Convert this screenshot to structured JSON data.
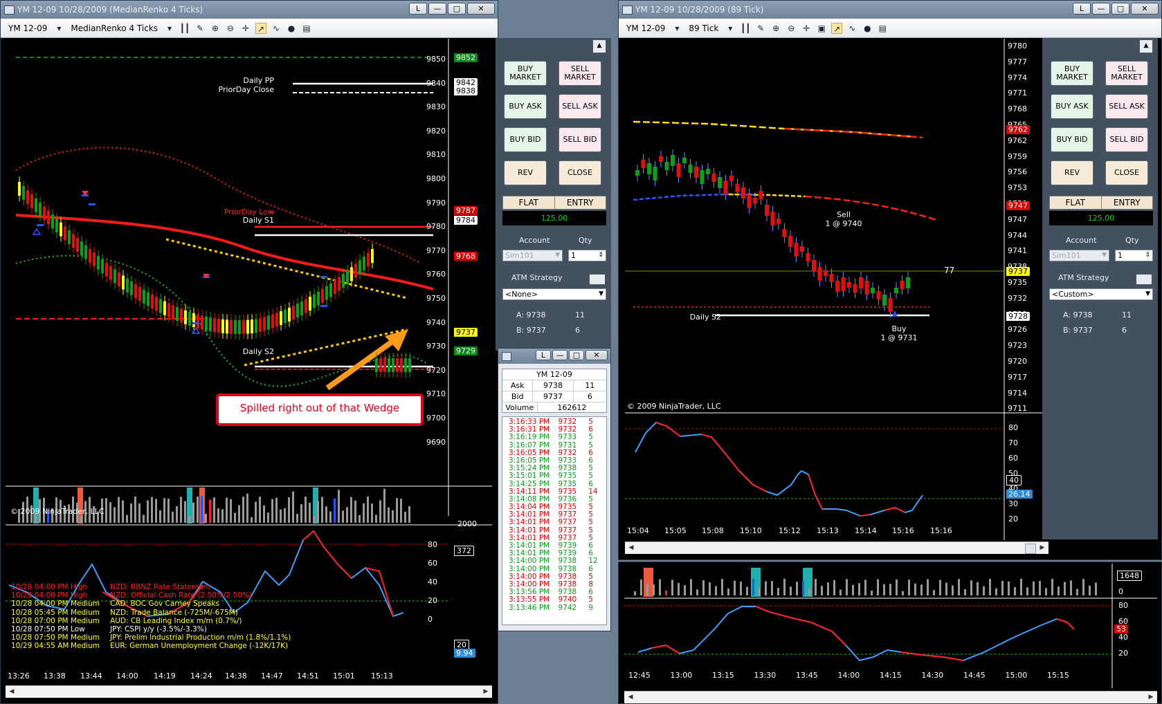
{
  "left_window": {
    "title": "YM 12-09  10/28/2009 (MedianRenko 4 Ticks)",
    "toolbar": {
      "instrument": "YM 12-09",
      "period": "MedianRenko 4 Ticks"
    },
    "price_axis": [
      "9850",
      "9840",
      "9830",
      "9820",
      "9810",
      "9800",
      "9790",
      "9780",
      "9770",
      "9760",
      "9750",
      "9740",
      "9730",
      "9720",
      "9710",
      "9700",
      "9690"
    ],
    "price_tags": {
      "top": "9852",
      "pp1": "9842",
      "pp2": "9840",
      "prior_close": "9838",
      "prior_low": "9787",
      "s1": "9784",
      "red_band": "9768",
      "last": "9737",
      "s2": "9729"
    },
    "levels": {
      "daily_pp": "Daily PP",
      "prior_close": "PriorDay Close",
      "prior_low": "PriorDay Low",
      "daily_s1": "Daily S1",
      "daily_s2": "Daily S2"
    },
    "callout": "Spilled right out of that Wedge",
    "copyright": "© 2009 NinjaTrader, LLC",
    "volume_axis": {
      "top": "2000",
      "tag": "372"
    },
    "osc_axis": [
      "80",
      "60",
      "40",
      "20",
      "0"
    ],
    "osc_tags": {
      "t20": "20",
      "val": "9.94"
    },
    "time_axis": [
      "13:26",
      "13:38",
      "13:44",
      "14:00",
      "14:19",
      "14:24",
      "14:38",
      "14:47",
      "14:51",
      "15:01",
      "15:13"
    ],
    "news": [
      {
        "time": "10/28 04:00 PM",
        "impact": "High",
        "text": "NZD: RBNZ Rate Statement",
        "color": "#ff2020"
      },
      {
        "time": "10/28 04:00 PM",
        "impact": "High",
        "text": "NZD: Official Cash Rate (2.50%/2.50%)",
        "color": "#ff2020"
      },
      {
        "time": "10/28 04:00 PM",
        "impact": "Medium",
        "text": "CAD: BOC Gov Carney Speaks",
        "color": "#ffff20"
      },
      {
        "time": "10/28 05:45 PM",
        "impact": "Medium",
        "text": "NZD: Trade Balance (-725M/-675M)",
        "color": "#ffff20"
      },
      {
        "time": "10/28 07:00 PM",
        "impact": "Medium",
        "text": "AUD: CB Leading Index m/m (0.7%/)",
        "color": "#ffff20"
      },
      {
        "time": "10/28 07:50 PM",
        "impact": "Low",
        "text": "JPY: CSPI y/y (-3.5%/-3.3%)",
        "color": "#ffffff"
      },
      {
        "time": "10/28 07:50 PM",
        "impact": "Medium",
        "text": "JPY: Prelim Industrial Production m/m (1.8%/1.1%)",
        "color": "#ffff20"
      },
      {
        "time": "10/29 04:55 AM",
        "impact": "Medium",
        "text": "EUR: German Unemployment Change (-12K/17K)",
        "color": "#ffff20"
      }
    ]
  },
  "order_panel_left": {
    "buy_market": "BUY MARKET",
    "sell_market": "SELL MARKET",
    "buy_ask": "BUY ASK",
    "sell_ask": "SELL ASK",
    "buy_bid": "BUY BID",
    "sell_bid": "SELL BID",
    "rev": "REV",
    "close": "CLOSE",
    "flat": "FLAT",
    "entry": "ENTRY",
    "pnl": "125.00",
    "account_label": "Account",
    "qty_label": "Qty",
    "account": "Sim101",
    "qty": "1",
    "atm_label": "ATM Strategy",
    "atm": "<None>",
    "a_label": "A: 9738",
    "a_size": "11",
    "b_label": "B: 9737",
    "b_size": "6"
  },
  "tas": {
    "instrument": "YM 12-09",
    "ask_label": "Ask",
    "ask": "9738",
    "ask_size": "11",
    "bid_label": "Bid",
    "bid": "9737",
    "bid_size": "6",
    "volume_label": "Volume",
    "volume": "162612",
    "rows": [
      {
        "t": "3:16:33 PM",
        "p": "9732",
        "s": "5",
        "c": "#e00000"
      },
      {
        "t": "3:16:31 PM",
        "p": "9732",
        "s": "6",
        "c": "#e00000"
      },
      {
        "t": "3:16:19 PM",
        "p": "9733",
        "s": "5",
        "c": "#0a9a1a"
      },
      {
        "t": "3:16:07 PM",
        "p": "9731",
        "s": "5",
        "c": "#0a9a1a"
      },
      {
        "t": "3:16:05 PM",
        "p": "9732",
        "s": "6",
        "c": "#e00000"
      },
      {
        "t": "3:16:05 PM",
        "p": "9733",
        "s": "6",
        "c": "#0a9a1a"
      },
      {
        "t": "3:15:24 PM",
        "p": "9738",
        "s": "5",
        "c": "#0a9a1a"
      },
      {
        "t": "3:15:01 PM",
        "p": "9735",
        "s": "5",
        "c": "#0a9a1a"
      },
      {
        "t": "3:14:25 PM",
        "p": "9735",
        "s": "6",
        "c": "#0a9a1a"
      },
      {
        "t": "3:14:11 PM",
        "p": "9735",
        "s": "14",
        "c": "#e00000"
      },
      {
        "t": "3:14:08 PM",
        "p": "9736",
        "s": "5",
        "c": "#0a9a1a"
      },
      {
        "t": "3:14:04 PM",
        "p": "9735",
        "s": "5",
        "c": "#e00000"
      },
      {
        "t": "3:14:01 PM",
        "p": "9737",
        "s": "5",
        "c": "#e00000"
      },
      {
        "t": "3:14:01 PM",
        "p": "9737",
        "s": "5",
        "c": "#e00000"
      },
      {
        "t": "3:14:01 PM",
        "p": "9737",
        "s": "5",
        "c": "#e00000"
      },
      {
        "t": "3:14:01 PM",
        "p": "9737",
        "s": "5",
        "c": "#e00000"
      },
      {
        "t": "3:14:01 PM",
        "p": "9739",
        "s": "6",
        "c": "#0a9a1a"
      },
      {
        "t": "3:14:01 PM",
        "p": "9739",
        "s": "6",
        "c": "#0a9a1a"
      },
      {
        "t": "3:14:00 PM",
        "p": "9738",
        "s": "12",
        "c": "#0a9a1a"
      },
      {
        "t": "3:14:00 PM",
        "p": "9738",
        "s": "6",
        "c": "#0a9a1a"
      },
      {
        "t": "3:14:00 PM",
        "p": "9738",
        "s": "5",
        "c": "#e00000"
      },
      {
        "t": "3:14:00 PM",
        "p": "9738",
        "s": "8",
        "c": "#e00000"
      },
      {
        "t": "3:13:56 PM",
        "p": "9738",
        "s": "6",
        "c": "#0a9a1a"
      },
      {
        "t": "3:13:55 PM",
        "p": "9740",
        "s": "5",
        "c": "#e00000"
      },
      {
        "t": "3:13:46 PM",
        "p": "9742",
        "s": "9",
        "c": "#0a9a1a"
      }
    ]
  },
  "right_window": {
    "title": "YM 12-09  10/28/2009 (89 Tick)",
    "toolbar": {
      "instrument": "YM 12-09",
      "period": "89 Tick"
    },
    "price_axis": [
      "9780",
      "9777",
      "9774",
      "9771",
      "9768",
      "9765",
      "9762",
      "9759",
      "9756",
      "9753",
      "9750",
      "9747",
      "9744",
      "9741",
      "9738",
      "9735",
      "9732",
      "9729",
      "9726",
      "9723",
      "9720",
      "9717",
      "9714",
      "9711"
    ],
    "price_tags": {
      "upper": "9762",
      "lower": "9747",
      "last": "9737",
      "s2": "9728"
    },
    "sell_label": "Sell",
    "sell_fill": "1 @ 9740",
    "buy_label": "Buy",
    "buy_fill": "1 @ 9731",
    "daily_s2": "Daily S2",
    "tick_count": "77",
    "copyright": "© 2009 NinjaTrader, LLC",
    "osc_axis": [
      "80",
      "70",
      "60",
      "50",
      "40",
      "30",
      "20"
    ],
    "osc_tags": {
      "t40": "40",
      "val": "26.14"
    },
    "time_axis": [
      "15:04",
      "15:05",
      "15:08",
      "15:10",
      "15:12",
      "15:13",
      "15:14",
      "15:16",
      "15:16"
    ]
  },
  "order_panel_right": {
    "buy_market": "BUY MARKET",
    "sell_market": "SELL MARKET",
    "buy_ask": "BUY ASK",
    "sell_ask": "SELL ASK",
    "buy_bid": "BUY BID",
    "sell_bid": "SELL BID",
    "rev": "REV",
    "close": "CLOSE",
    "flat": "FLAT",
    "entry": "ENTRY",
    "pnl": "125.00",
    "account_label": "Account",
    "qty_label": "Qty",
    "account": "Sim101",
    "qty": "1",
    "atm_label": "ATM Strategy",
    "atm": "<Custom>",
    "a_label": "A: 9738",
    "a_size": "11",
    "b_label": "B: 9737",
    "b_size": "6"
  },
  "bottom_right": {
    "volume_tag": "1648",
    "volume_zero": "0",
    "osc_axis": [
      "80",
      "60",
      "40",
      "20"
    ],
    "osc_tag": "53",
    "time_axis": [
      "12:45",
      "13:00",
      "13:15",
      "13:30",
      "13:45",
      "14:00",
      "14:15",
      "14:30",
      "14:45",
      "15:00",
      "15:15"
    ]
  },
  "window_buttons": {
    "minimize": "L",
    "restore": "□",
    "close": "✕"
  }
}
